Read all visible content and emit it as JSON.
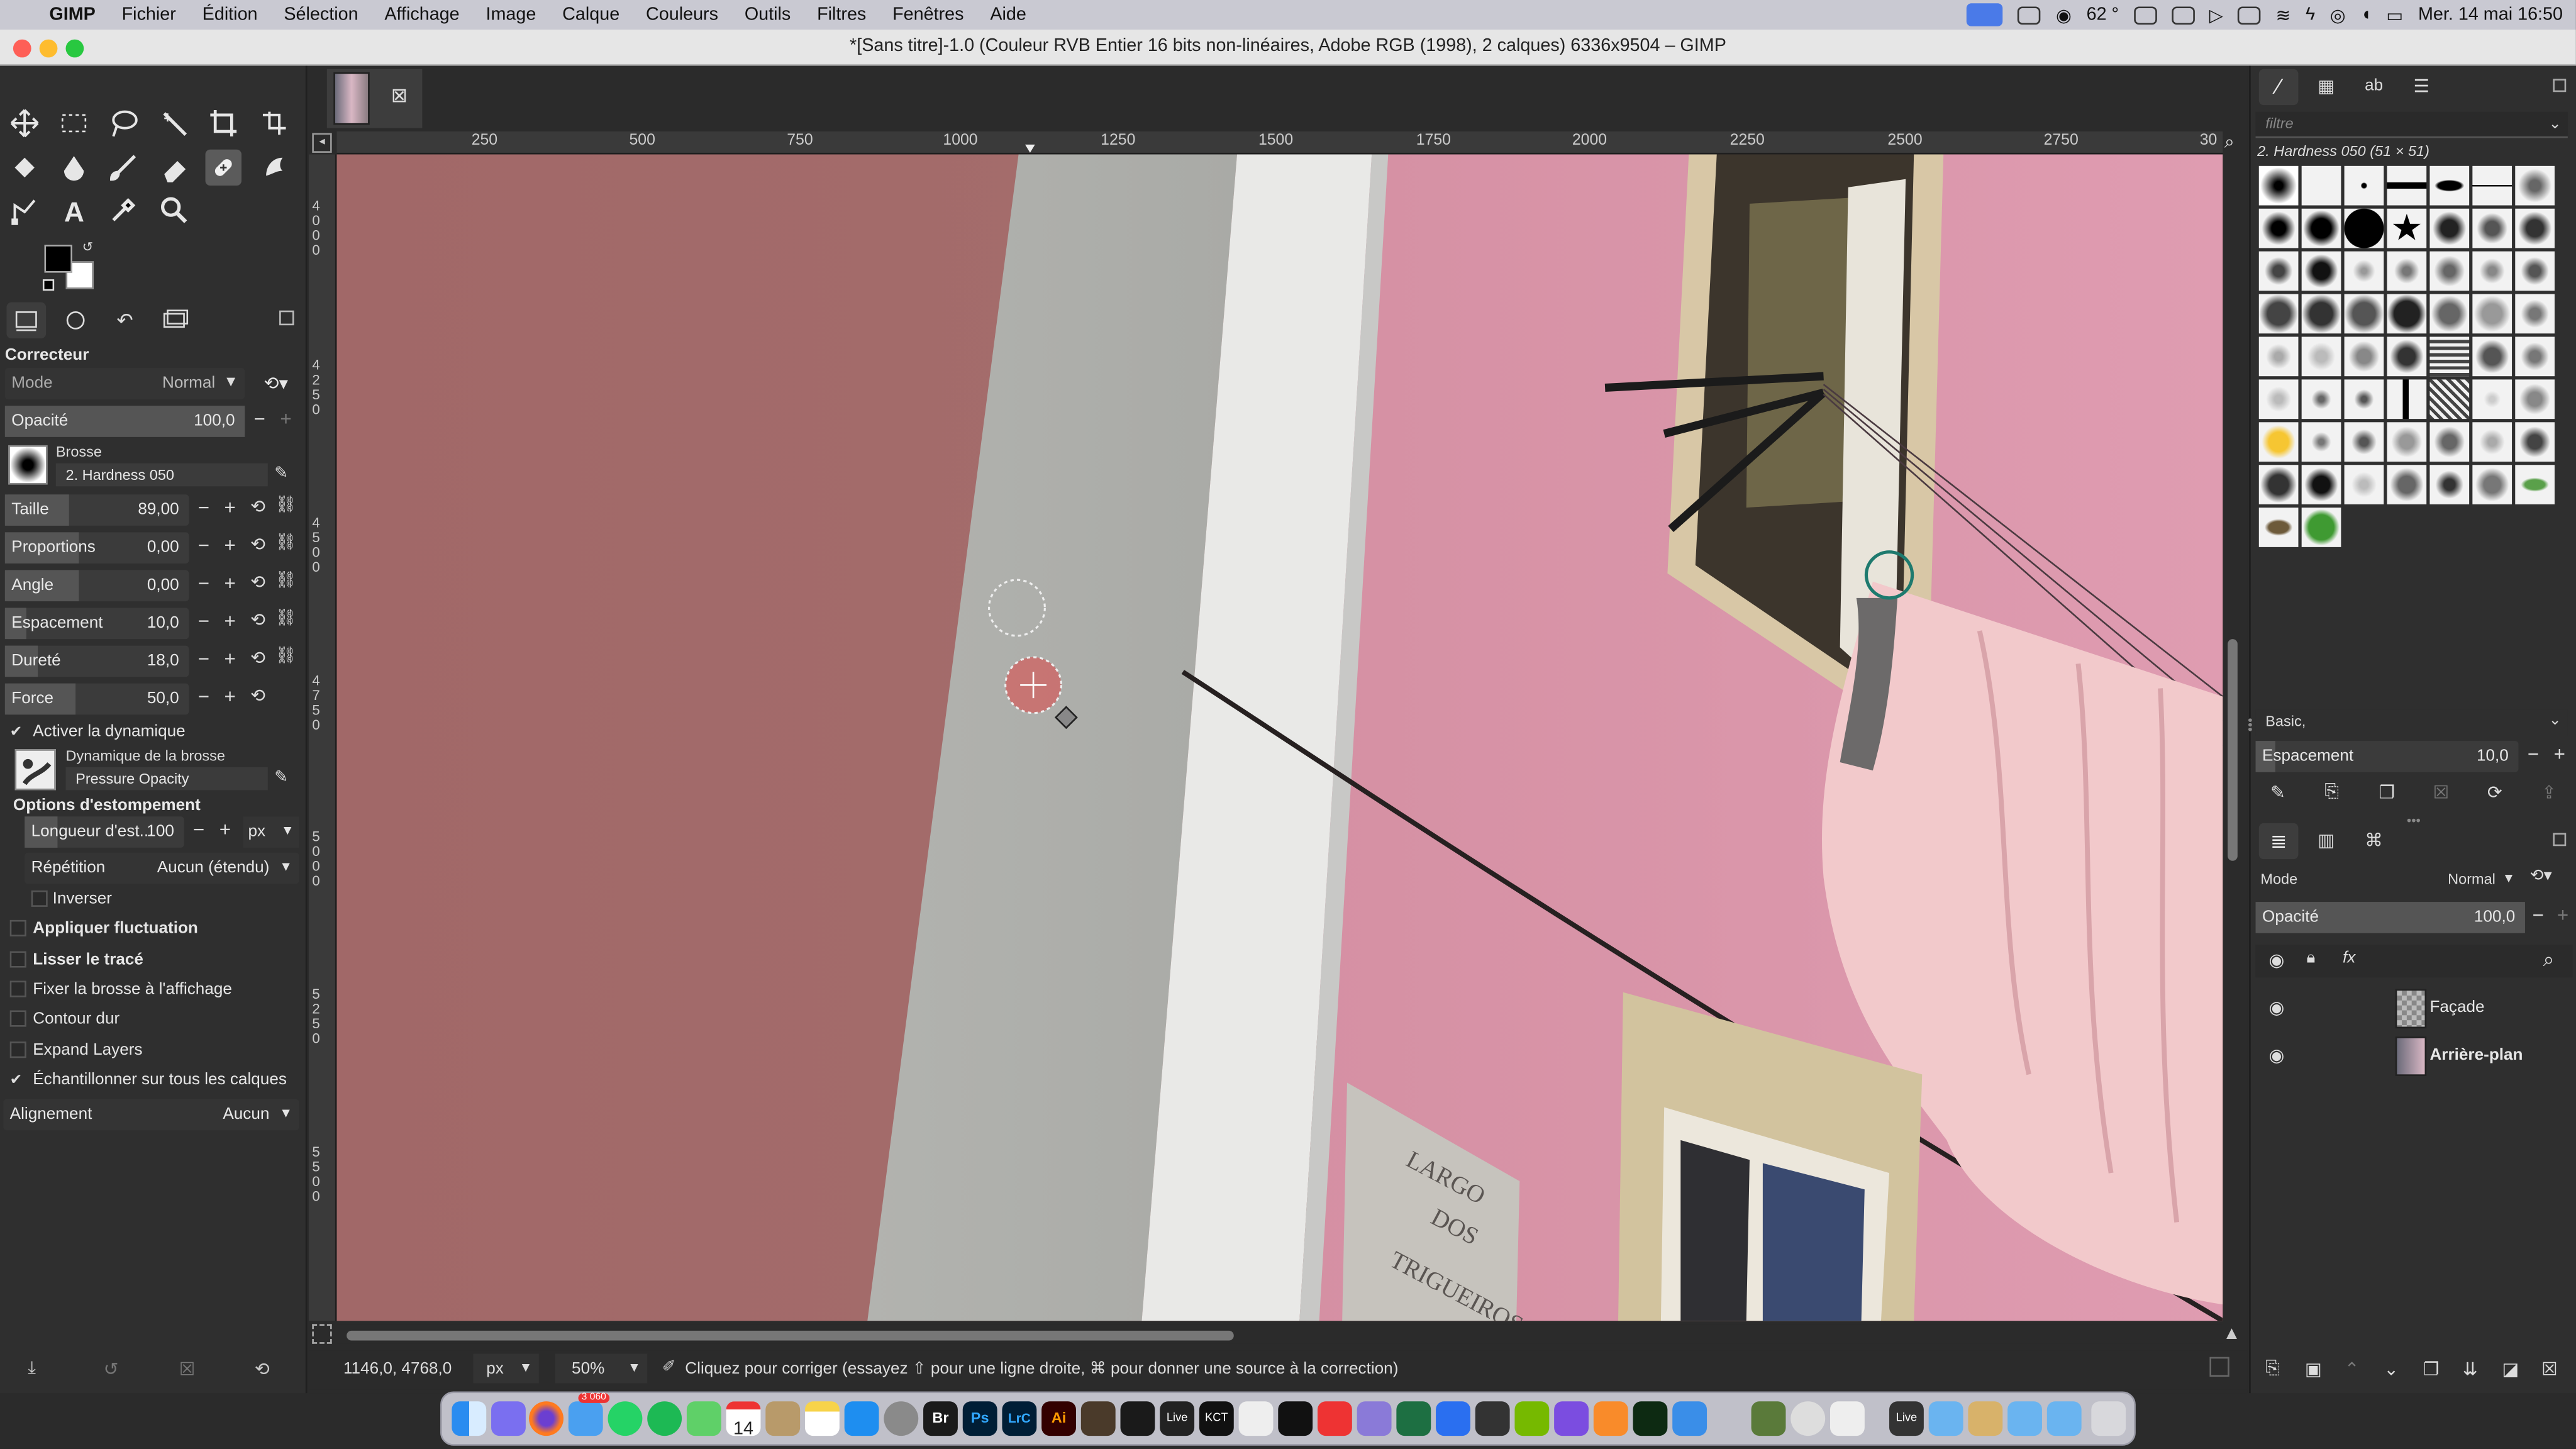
{
  "menubar": {
    "apple": "",
    "items": [
      "GIMP",
      "Fichier",
      "Édition",
      "Sélection",
      "Affichage",
      "Image",
      "Calque",
      "Couleurs",
      "Outils",
      "Filtres",
      "Fenêtres",
      "Aide"
    ],
    "battery": "62 °",
    "clock": "Mer. 14 mai  16:50"
  },
  "window": {
    "title": "*[Sans titre]-1.0 (Couleur RVB Entier 16 bits non-linéaires, Adobe RGB (1998), 2 calques) 6336x9504 – GIMP"
  },
  "tool_options": {
    "tool_name": "Correcteur",
    "mode_label": "Mode",
    "mode_value": "Normal",
    "opacity_label": "Opacité",
    "opacity_value": "100,0",
    "brush_label": "Brosse",
    "brush_name": "2. Hardness 050",
    "size_label": "Taille",
    "size_value": "89,00",
    "size_fill": 0.35,
    "aspect_label": "Proportions",
    "aspect_value": "0,00",
    "aspect_fill": 0.4,
    "angle_label": "Angle",
    "angle_value": "0,00",
    "angle_fill": 0.4,
    "spacing_label": "Espacement",
    "spacing_value": "10,0",
    "spacing_fill": 0.12,
    "hardness_label": "Dureté",
    "hardness_value": "18,0",
    "hardness_fill": 0.18,
    "force_label": "Force",
    "force_value": "50,0",
    "force_fill": 0.38,
    "dynamics_enable": "Activer la dynamique",
    "dynamics_label": "Dynamique de la brosse",
    "dynamics_name": "Pressure Opacity",
    "fade_header": "Options d'estompement",
    "fade_length_label": "Longueur d'est...",
    "fade_length_value": "100",
    "fade_unit": "px",
    "repeat_label": "Répétition",
    "repeat_value": "Aucun (étendu)",
    "reverse_label": "Inverser",
    "jitter_label": "Appliquer fluctuation",
    "smooth_label": "Lisser le tracé",
    "lock_brush_label": "Fixer la brosse à l'affichage",
    "hard_edge_label": "Contour dur",
    "expand_layers_label": "Expand Layers",
    "sample_merged_label": "Échantillonner sur tous les calques",
    "alignment_label": "Alignement",
    "alignment_value": "Aucun"
  },
  "rulers": {
    "h_ticks": [
      "250",
      "500",
      "750",
      "1000",
      "1250",
      "1500",
      "1750",
      "2000",
      "2250",
      "2500",
      "2750",
      "30"
    ],
    "v_ticks": [
      "4000",
      "4250",
      "4500",
      "4750",
      "5000",
      "5250",
      "5500"
    ]
  },
  "sign": {
    "line1": "LARGO",
    "line2": "DOS",
    "line3": "TRIGUEIROS"
  },
  "statusbar": {
    "coords": "1146,0, 4768,0",
    "unit": "px",
    "zoom": "50%",
    "message": "Cliquez pour corriger (essayez ⇧ pour une ligne droite, ⌘ pour donner une source à la correction)"
  },
  "brushes_panel": {
    "filter_placeholder": "filtre",
    "current_brush": "2. Hardness 050 (51 × 51)",
    "preset": "Basic,",
    "spacing_label": "Espacement",
    "spacing_value": "10,0"
  },
  "layers_panel": {
    "mode_label": "Mode",
    "mode_value": "Normal",
    "opacity_label": "Opacité",
    "opacity_value": "100,0",
    "layers": [
      {
        "name": "Façade"
      },
      {
        "name": "Arrière-plan"
      }
    ]
  },
  "dock": {
    "mail_badge": "3 060",
    "calendar_day": "14"
  },
  "colors": {
    "fg": "#000000",
    "bg": "#ffffff",
    "accent": "#4a7ae8",
    "facade_left": "#a36a6a",
    "facade_pink": "#d98ea8"
  }
}
